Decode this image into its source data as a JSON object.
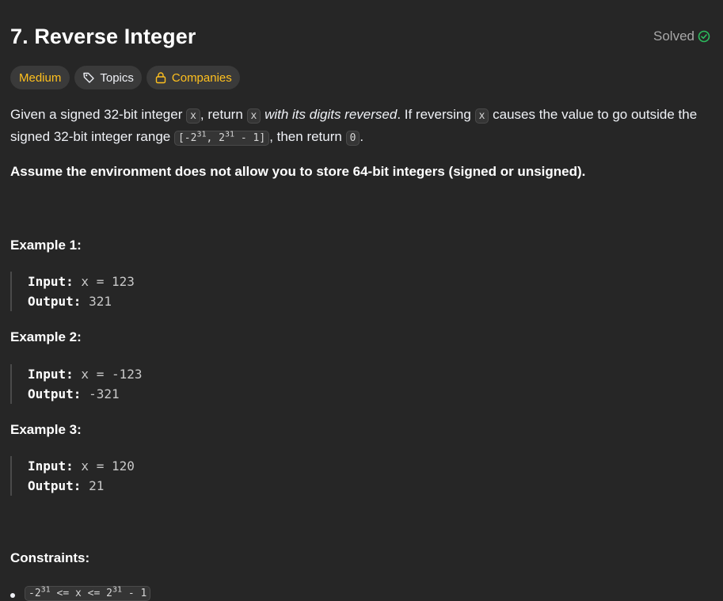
{
  "problem": {
    "title": "7. Reverse Integer",
    "status": "Solved",
    "difficulty": "Medium",
    "topics_label": "Topics",
    "companies_label": "Companies"
  },
  "description": {
    "p1_a": "Given a signed 32-bit integer ",
    "code_x": "x",
    "p1_b": ", return ",
    "p1_italic": "with its digits reversed",
    "p1_c": ". If reversing ",
    "p1_d": " causes the value to go outside the signed 32-bit integer range ",
    "range_a": "[-2",
    "range_exp1": "31",
    "range_b": ", 2",
    "range_exp2": "31",
    "range_c": " - 1]",
    "p1_e": ", then return ",
    "code_zero": "0",
    "p1_f": ".",
    "note": "Assume the environment does not allow you to store 64-bit integers (signed or unsigned)."
  },
  "examples": [
    {
      "title": "Example 1:",
      "input_label": "Input:",
      "input": " x = 123",
      "output_label": "Output:",
      "output": " 321"
    },
    {
      "title": "Example 2:",
      "input_label": "Input:",
      "input": " x = -123",
      "output_label": "Output:",
      "output": " -321"
    },
    {
      "title": "Example 3:",
      "input_label": "Input:",
      "input": " x = 120",
      "output_label": "Output:",
      "output": " 21"
    }
  ],
  "constraints": {
    "title": "Constraints:",
    "item_a": "-2",
    "item_exp1": "31",
    "item_b": " <= x <= 2",
    "item_exp2": "31",
    "item_c": " - 1"
  },
  "colors": {
    "background": "#262626",
    "medium": "#ffc01e",
    "solved_check": "#2cbb5d",
    "text": "#eff1f6"
  }
}
